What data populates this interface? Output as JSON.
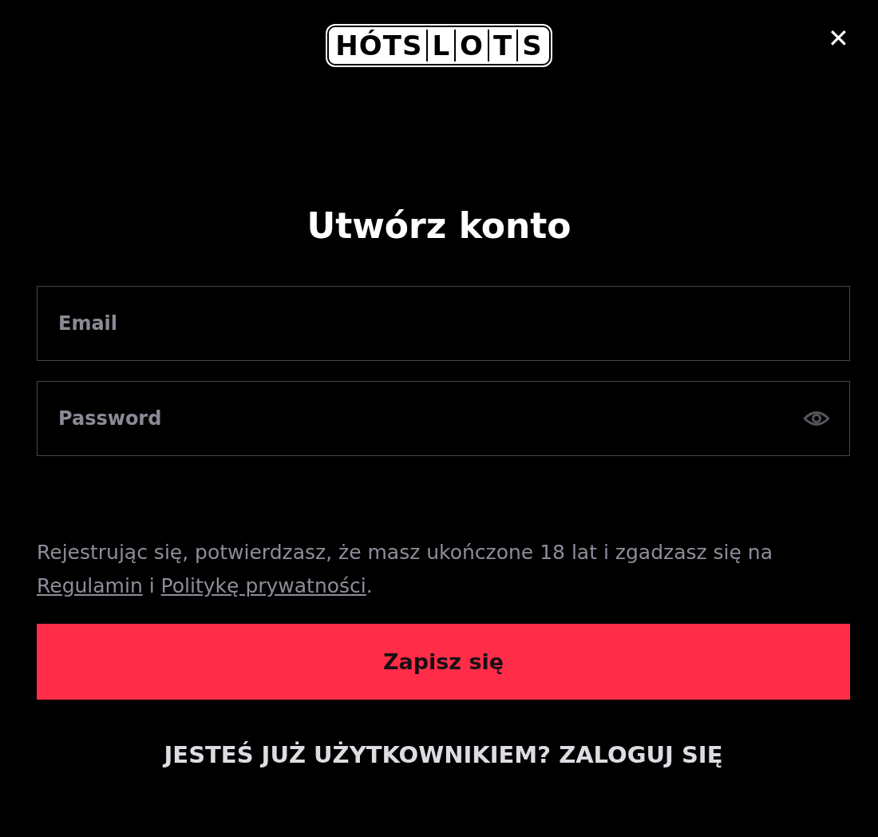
{
  "logo": {
    "tiles": [
      "HÓTS",
      "L",
      "O",
      "T",
      "S"
    ]
  },
  "close": {
    "glyph": "✕"
  },
  "title": "Utwórz konto",
  "fields": [
    {
      "kind": "text",
      "placeholder": "Email"
    },
    {
      "kind": "password",
      "placeholder": "Password"
    }
  ],
  "terms": [
    {
      "kind": "text",
      "text": "Rejestrując się, potwierdzasz, że masz ukończone 18 lat i zgadzasz się na "
    },
    {
      "kind": "link",
      "text": "Regulamin"
    },
    {
      "kind": "text",
      "text": " i "
    },
    {
      "kind": "link",
      "text": "Politykę prywatności"
    },
    {
      "kind": "text",
      "text": "."
    }
  ],
  "submit": "Zapisz się",
  "login_link": "JESTEŚ JUŻ UŻYTKOWNIKIEM? ZALOGUJ SIĘ"
}
